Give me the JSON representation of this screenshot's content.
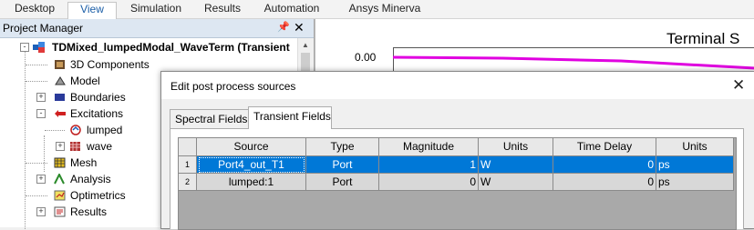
{
  "ribbon": {
    "tabs": [
      "Desktop",
      "View",
      "Simulation",
      "Results",
      "Automation",
      "Ansys Minerva"
    ],
    "active": "View"
  },
  "project_manager": {
    "title": "Project Manager",
    "pin_glyph": "📌",
    "close_glyph": "✕",
    "tree": [
      {
        "label": "TDMixed_lumpedModal_WaveTerm (Transient",
        "icon": "design-icon",
        "expander": "-"
      },
      {
        "label": "3D Components",
        "icon": "components-icon",
        "expander": ""
      },
      {
        "label": "Model",
        "icon": "model-icon",
        "expander": ""
      },
      {
        "label": "Boundaries",
        "icon": "boundaries-icon",
        "expander": "+"
      },
      {
        "label": "Excitations",
        "icon": "excitations-icon",
        "expander": "-"
      },
      {
        "label": "lumped",
        "icon": "lumped-port-icon",
        "expander": ""
      },
      {
        "label": "wave",
        "icon": "wave-port-icon",
        "expander": "+"
      },
      {
        "label": "Mesh",
        "icon": "mesh-icon",
        "expander": ""
      },
      {
        "label": "Analysis",
        "icon": "analysis-icon",
        "expander": "+"
      },
      {
        "label": "Optimetrics",
        "icon": "optimetrics-icon",
        "expander": ""
      },
      {
        "label": "Results",
        "icon": "results-icon",
        "expander": "+"
      }
    ]
  },
  "plot": {
    "title": "Terminal S",
    "ytick": "0.00",
    "colors": {
      "trace": "#e000e0"
    }
  },
  "dialog": {
    "title": "Edit post process sources",
    "close_glyph": "✕",
    "tabs": [
      "Spectral Fields",
      "Transient Fields"
    ],
    "active_tab": "Transient Fields",
    "columns": [
      "Source",
      "Type",
      "Magnitude",
      "Units",
      "Time Delay",
      "Units"
    ],
    "rows": [
      {
        "num": "1",
        "source": "Port4_out_T1",
        "type": "Port",
        "magnitude": "1",
        "units": "W",
        "delay": "0",
        "delay_units": "ps",
        "selected": true
      },
      {
        "num": "2",
        "source": "lumped:1",
        "type": "Port",
        "magnitude": "0",
        "units": "W",
        "delay": "0",
        "delay_units": "ps",
        "selected": false
      }
    ],
    "colors": {
      "selection": "#0078d7",
      "row_bg": "#d8d8d8",
      "grid_bg": "#a9a9a9"
    }
  }
}
